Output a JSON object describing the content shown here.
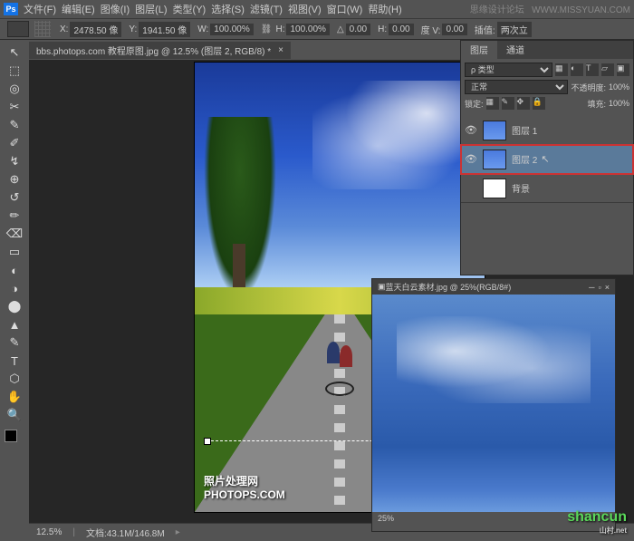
{
  "watermarks": {
    "top_text": "思缘设计论坛",
    "top_url": "WWW.MISSYUAN.COM",
    "bottom": "shancun",
    "bottom_sub": "山村.net"
  },
  "menu": {
    "items": [
      "文件(F)",
      "编辑(E)",
      "图像(I)",
      "图层(L)",
      "类型(Y)",
      "选择(S)",
      "滤镜(T)",
      "视图(V)",
      "窗口(W)",
      "帮助(H)"
    ]
  },
  "options": {
    "x_label": "X:",
    "x_value": "2478.50 像",
    "y_label": "Y:",
    "y_value": "1941.50 像",
    "w_label": "W:",
    "w_value": "100.00%",
    "h_label": "H:",
    "h_value": "100.00%",
    "angle_label": "△",
    "angle_value": "0.00",
    "skew_h_label": "H:",
    "skew_h_value": "0.00",
    "skew_v_label": "度  V:",
    "skew_v_value": "0.00",
    "interp_label": "插值:",
    "interp_value": "两次立"
  },
  "document": {
    "tab_title": "bbs.photops.com 教程原图.jpg @ 12.5% (图层 2, RGB/8) *",
    "watermark_line1": "照片处理网",
    "watermark_line2": "PHOTOPS.COM"
  },
  "status": {
    "zoom": "12.5%",
    "doc_info": "文档:43.1M/146.8M"
  },
  "layers_panel": {
    "tab_layers": "图层",
    "tab_channels": "通道",
    "kind_label": "ρ 类型",
    "blend_mode": "正常",
    "opacity_label": "不透明度:",
    "opacity_value": "100%",
    "lock_label": "锁定:",
    "fill_label": "填充:",
    "fill_value": "100%",
    "layers": [
      {
        "name": "图层 1",
        "visible": true
      },
      {
        "name": "图层 2",
        "visible": true,
        "selected": true,
        "highlighted": true
      },
      {
        "name": "背景",
        "visible": false
      }
    ]
  },
  "second_doc": {
    "title": "蓝天白云素材.jpg @ 25%(RGB/8#)",
    "zoom": "25%"
  },
  "tools": [
    "↖",
    "⬚",
    "◎",
    "✂",
    "✎",
    "✐",
    "↯",
    "⊕",
    "↺",
    "✏",
    "⌫",
    "▭",
    "◐",
    "◑",
    "⬤",
    "▲",
    "✎",
    "T",
    "⬡",
    "✋",
    "🔍"
  ]
}
